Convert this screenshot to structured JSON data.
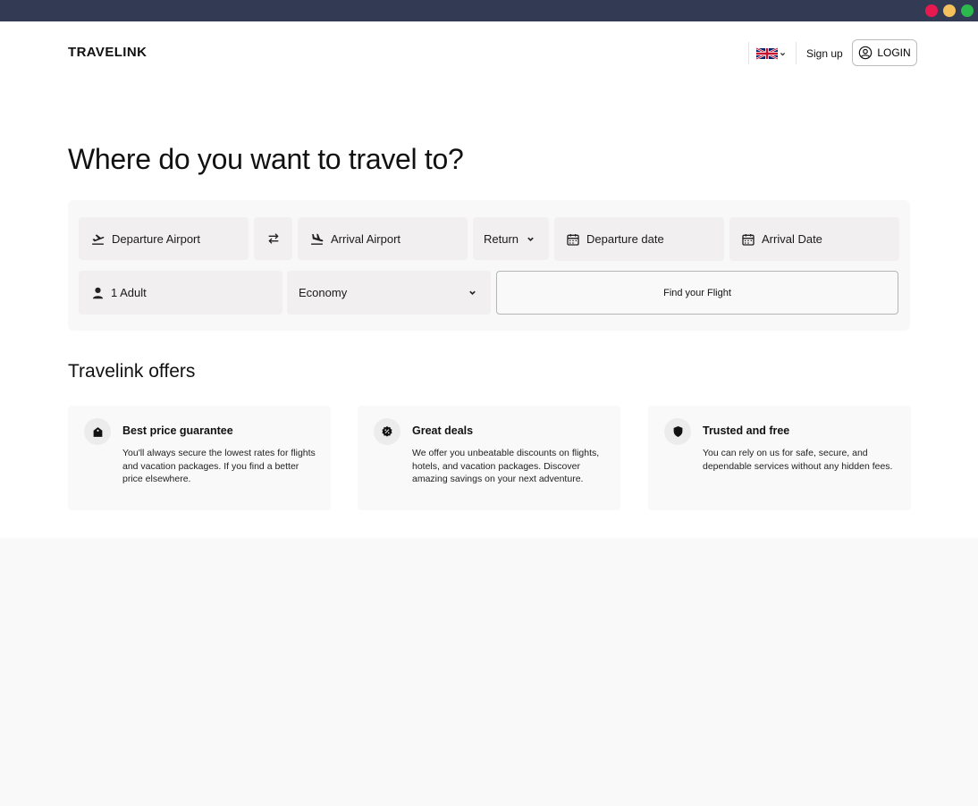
{
  "window": {
    "controls": [
      {
        "name": "close",
        "color": "#e8194f"
      },
      {
        "name": "minimize",
        "color": "#f5c15c"
      },
      {
        "name": "maximize",
        "color": "#2bb84d"
      }
    ]
  },
  "header": {
    "brand": "TRAVELINK",
    "language_icon": "uk-flag-icon",
    "signup_label": "Sign up",
    "login_label": "LOGIN"
  },
  "hero": {
    "title": "Where do you want to travel to?"
  },
  "search": {
    "departure_airport": "Departure Airport",
    "arrival_airport": "Arrival Airport",
    "trip_type": "Return",
    "departure_date": "Departure date",
    "arrival_date": "Arrival Date",
    "passengers": "1 Adult",
    "cabin_class": "Economy",
    "submit_label": "Find your Flight"
  },
  "offers": {
    "title": "Travelink offers",
    "items": [
      {
        "icon": "price-tag-icon",
        "title": "Best price guarantee",
        "text": "You'll always secure the lowest rates for flights and vacation packages. If you find a better price elsewhere."
      },
      {
        "icon": "discount-badge-icon",
        "title": "Great deals",
        "text": "We offer you unbeatable discounts on flights, hotels, and vacation packages. Discover amazing savings on your next adventure."
      },
      {
        "icon": "shield-icon",
        "title": "Trusted and free",
        "text": "You can rely on us for safe, secure, and dependable services without any hidden fees."
      }
    ]
  }
}
